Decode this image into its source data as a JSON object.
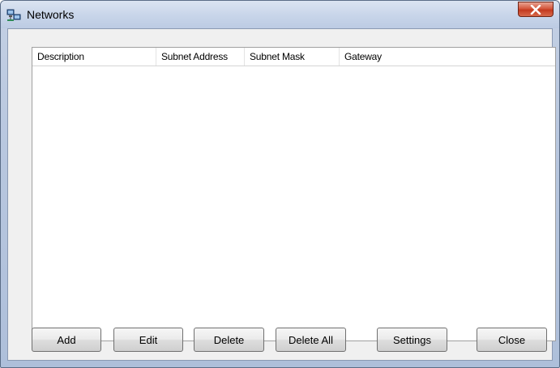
{
  "window": {
    "title": "Networks"
  },
  "listview": {
    "columns": [
      "Description",
      "Subnet Address",
      "Subnet Mask",
      "Gateway"
    ],
    "rows": []
  },
  "buttons": {
    "add": "Add",
    "edit": "Edit",
    "delete": "Delete",
    "delete_all": "Delete All",
    "settings": "Settings",
    "close": "Close"
  },
  "icons": {
    "app": "network-computers-icon",
    "close": "close-x-icon"
  },
  "colors": {
    "titlebar": "#c9d6ea",
    "close_button": "#c33a1f",
    "dialog_background": "#f0f0f0"
  }
}
